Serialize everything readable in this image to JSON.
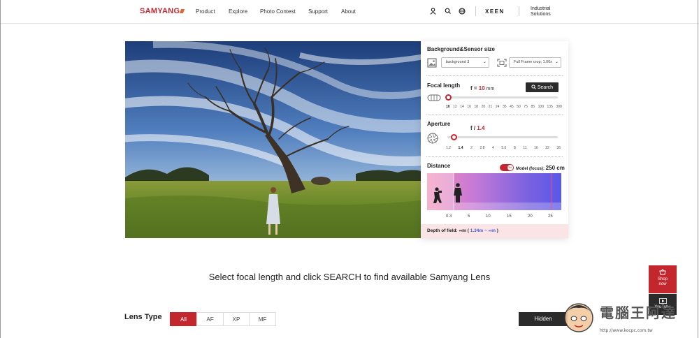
{
  "header": {
    "brand": "SAMYANG",
    "nav": [
      "Product",
      "Explore",
      "Photo Contest",
      "Support",
      "About"
    ],
    "icons": [
      "user-icon",
      "search-icon",
      "globe-icon"
    ],
    "xeen": "XEEN",
    "industrial_line1": "Industrial",
    "industrial_line2": "Solutions"
  },
  "panel": {
    "background_title": "Background&Sensor size",
    "background_select": "background 3",
    "sensor_select": "Full Frame crop; 1.00x",
    "focal_title": "Focal length",
    "focal_prefix": "f = ",
    "focal_value": "10",
    "focal_unit": " mm",
    "search_label": "Search",
    "focal_ticks": [
      "10",
      "12",
      "14",
      "16",
      "18",
      "20",
      "21",
      "24",
      "35",
      "45",
      "50",
      "75",
      "85",
      "100",
      "135",
      "300"
    ],
    "focal_slider_fraction": 0,
    "aperture_title": "Aperture",
    "aperture_prefix": "f / ",
    "aperture_value": "1.4",
    "aperture_ticks": [
      "1.2",
      "1.4",
      "2",
      "2.8",
      "4",
      "5.6",
      "8",
      "11",
      "16",
      "22",
      "36"
    ],
    "aperture_slider_fraction": 0.05,
    "distance_title": "Distance",
    "toggle_label": "ON",
    "model_label": "Model (focus): ",
    "model_value": "250 cm",
    "distance_ticks": [
      "0.3",
      "5",
      "10",
      "15",
      "20",
      "25"
    ],
    "dof_label": "Depth of field: ",
    "dof_far_start": "∞m",
    "dof_open": " ( ",
    "dof_near": "1.34m",
    "dof_dash": " ~ ",
    "dof_far": "∞m",
    "dof_close": " )"
  },
  "instruction": "Select focal length and click SEARCH to find available Samyang Lens",
  "lens": {
    "title": "Lens Type",
    "tabs": [
      "All",
      "AF",
      "XP",
      "MF"
    ],
    "active_tab": "All",
    "dropdown": "Hidden"
  },
  "floating": {
    "shop_line1": "Shop",
    "shop_line2": "now",
    "youtube": "YouTube"
  },
  "watermark": {
    "text": "電腦王阿達",
    "url": "http://www.kocpc.com.tw"
  },
  "colors": {
    "brand_red": "#c4262e",
    "dark": "#2b2b2b",
    "dof_blue": "#4a5fd0"
  }
}
